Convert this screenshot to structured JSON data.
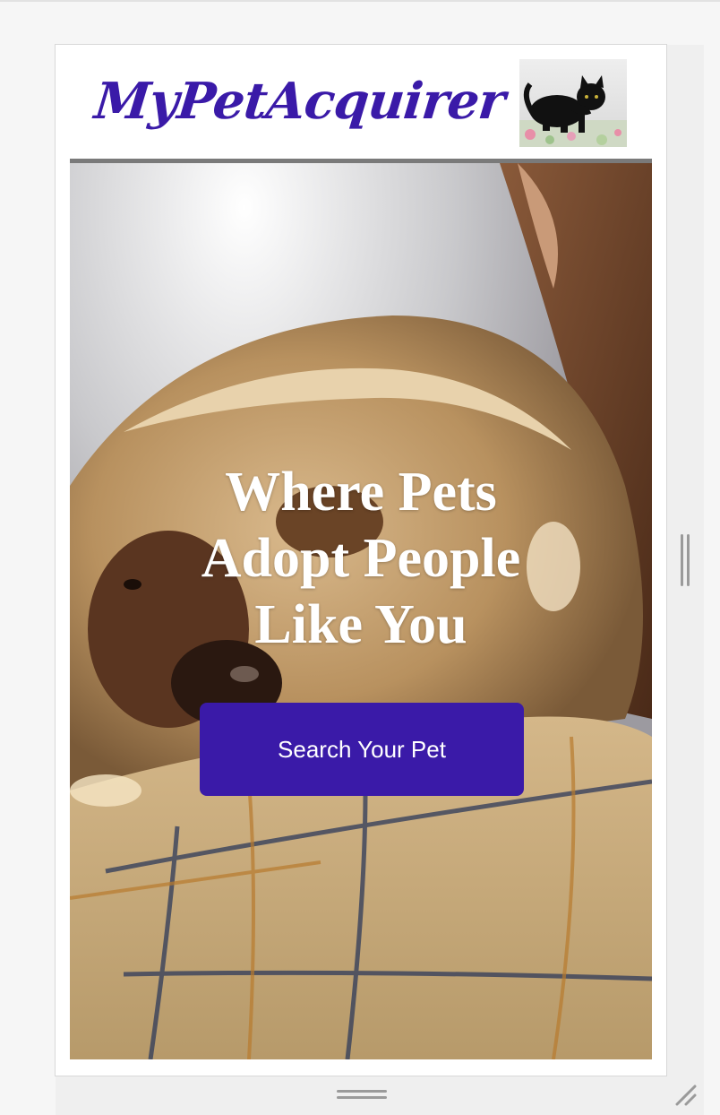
{
  "header": {
    "logo_text": "MyPetAcquirer",
    "logo_color": "#3a1aa8",
    "thumbnail_icon": "black-cat-photo"
  },
  "hero": {
    "background_icon": "dog-photo",
    "headline_lines": [
      "Where Pets",
      "Adopt People",
      "Like You"
    ],
    "cta_label": "Search Your Pet",
    "cta_color": "#3a1aa8"
  },
  "emulator": {
    "right_handle_icon": "resize-handle-vertical-icon",
    "bottom_handle_icon": "resize-handle-horizontal-icon",
    "corner_handle_icon": "resize-corner-icon"
  }
}
